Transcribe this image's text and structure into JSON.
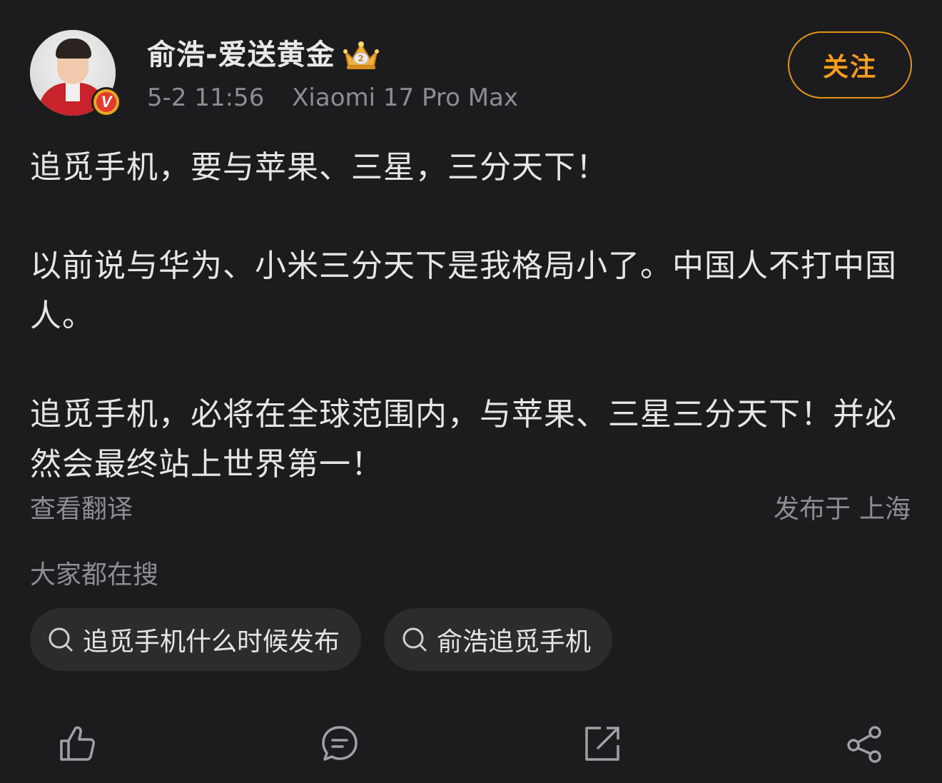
{
  "post_header": {
    "username": "俞浩-爱送黄金",
    "badge_icon": "crown-level-badge",
    "verified_icon": "verified-v-badge",
    "timestamp": "5-2 11:56",
    "device": "Xiaomi 17 Pro Max",
    "follow_label": "关注"
  },
  "post": {
    "paragraphs": [
      "追觅手机，要与苹果、三星，三分天下！",
      "以前说与华为、小米三分天下是我格局小了。中国人不打中国人。",
      "追觅手机，必将在全球范围内，与苹果、三星三分天下！并必然会最终站上世界第一！"
    ],
    "translate_label": "查看翻译",
    "location_prefix": "发布于",
    "location_city": "上海"
  },
  "search": {
    "title": "大家都在搜",
    "chips": [
      "追觅手机什么时候发布",
      "俞浩追觅手机"
    ]
  },
  "actions": {
    "icons": [
      "like-icon",
      "comment-icon",
      "repost-icon",
      "share-icon"
    ]
  },
  "colors": {
    "background": "#1c1c1e",
    "accent": "#f59e1a",
    "muted_text": "#8d8d92",
    "chip_background": "#2c2c2e"
  }
}
